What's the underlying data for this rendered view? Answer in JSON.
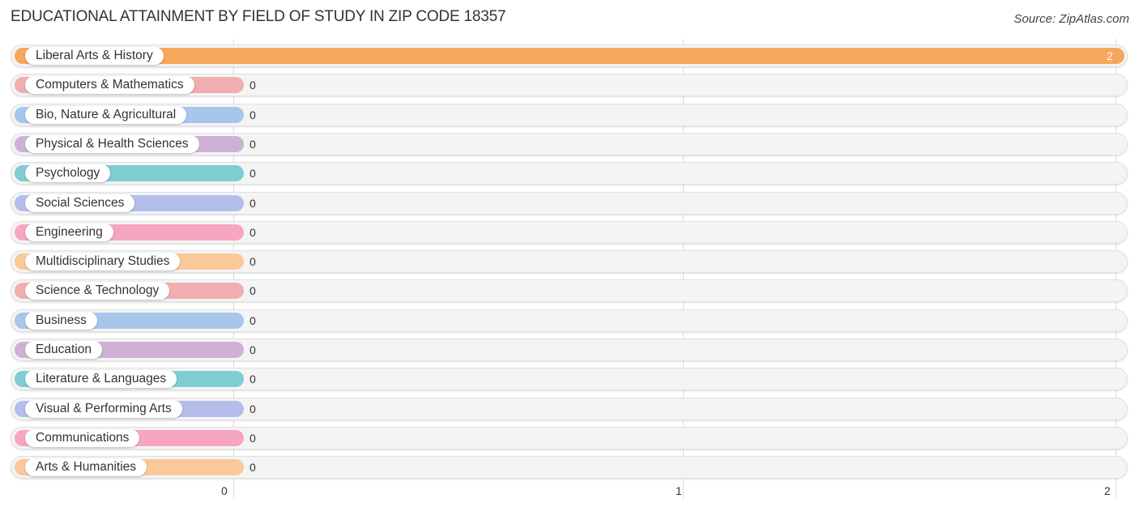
{
  "header": {
    "title": "EDUCATIONAL ATTAINMENT BY FIELD OF STUDY IN ZIP CODE 18357",
    "source": "Source: ZipAtlas.com"
  },
  "chart_data": {
    "type": "bar",
    "orientation": "horizontal",
    "title": "EDUCATIONAL ATTAINMENT BY FIELD OF STUDY IN ZIP CODE 18357",
    "xlabel": "",
    "ylabel": "",
    "xlim": [
      0,
      2
    ],
    "xticks": [
      "0",
      "1",
      "2"
    ],
    "grid": true,
    "categories": [
      "Liberal Arts & History",
      "Computers & Mathematics",
      "Bio, Nature & Agricultural",
      "Physical & Health Sciences",
      "Psychology",
      "Social Sciences",
      "Engineering",
      "Multidisciplinary Studies",
      "Science & Technology",
      "Business",
      "Education",
      "Literature & Languages",
      "Visual & Performing Arts",
      "Communications",
      "Arts & Humanities"
    ],
    "values": [
      2,
      0,
      0,
      0,
      0,
      0,
      0,
      0,
      0,
      0,
      0,
      0,
      0,
      0,
      0
    ],
    "value_labels": [
      "2",
      "0",
      "0",
      "0",
      "0",
      "0",
      "0",
      "0",
      "0",
      "0",
      "0",
      "0",
      "0",
      "0",
      "0"
    ],
    "colors": [
      "#f7a75b",
      "#f0aeb0",
      "#a7c6ec",
      "#cfb1d6",
      "#7ecdd3",
      "#b5bdeb",
      "#f7a6c2",
      "#fbc89a",
      "#f0aeb0",
      "#a7c6ec",
      "#cfb1d6",
      "#7ecdd3",
      "#b5bdeb",
      "#f7a6c2",
      "#fbc89a"
    ]
  }
}
